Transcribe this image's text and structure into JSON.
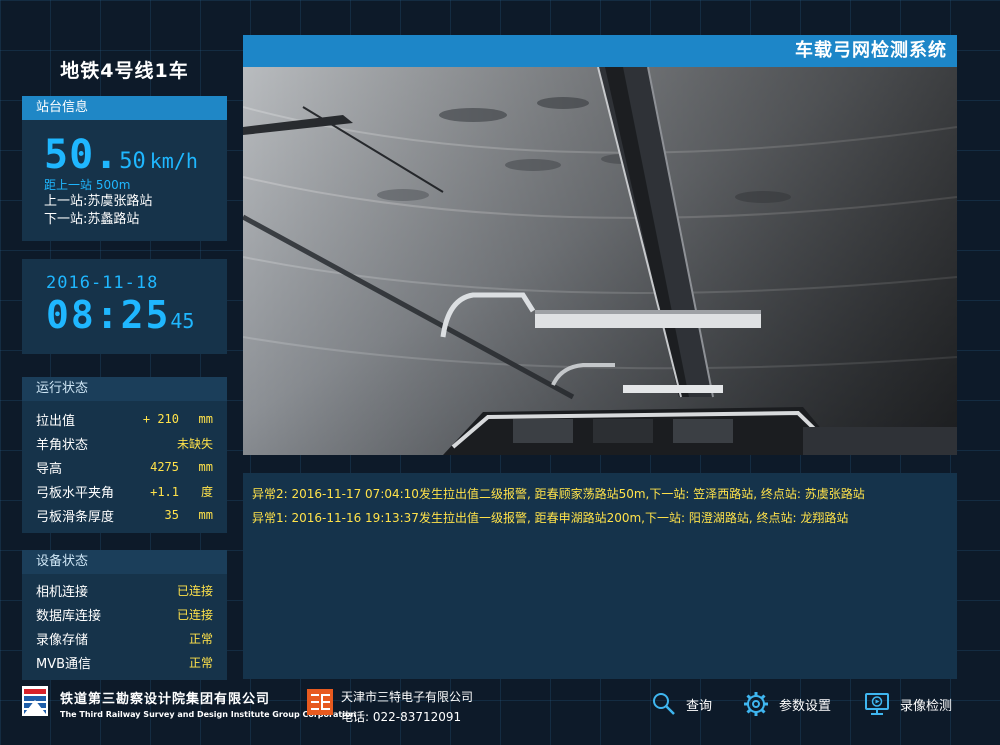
{
  "train_title": "地铁4号线1车",
  "station_info": {
    "header": "站台信息",
    "speed_main": "50.",
    "speed_decimal": "50",
    "speed_unit": "km/h",
    "distance_prev": "距上一站 500m",
    "prev_station": "上一站:苏虞张路站",
    "next_station": "下一站:苏蠡路站"
  },
  "clock": {
    "date": "2016-11-18",
    "time_hm": "08:25",
    "time_sec": "45"
  },
  "run_status": {
    "header": "运行状态",
    "rows": [
      {
        "label": "拉出值",
        "value": "+ 210",
        "unit": "mm"
      },
      {
        "label": "羊角状态",
        "value": "未缺失",
        "unit": ""
      },
      {
        "label": "导高",
        "value": "4275",
        "unit": "mm"
      },
      {
        "label": "弓板水平夹角",
        "value": "+1.1",
        "unit": "度"
      },
      {
        "label": "弓板滑条厚度",
        "value": "35",
        "unit": "mm"
      }
    ]
  },
  "device_status": {
    "header": "设备状态",
    "rows": [
      {
        "label": "相机连接",
        "value": "已连接"
      },
      {
        "label": "数据库连接",
        "value": "已连接"
      },
      {
        "label": "录像存储",
        "value": "正常"
      },
      {
        "label": "MVB通信",
        "value": "正常"
      }
    ]
  },
  "system_title": "车载弓网检测系统",
  "alarms": [
    "异常2: 2016-11-17 07:04:10发生拉出值二级报警, 距春顾家荡路站50m,下一站: 笠泽西路站, 终点站: 苏虞张路站",
    "异常1: 2016-11-16 19:13:37发生拉出值一级报警, 距春申湖路站200m,下一站: 阳澄湖路站, 终点站: 龙翔路站"
  ],
  "footer": {
    "company1_cn": "铁道第三勘察设计院集团有限公司",
    "company1_en": "The Third Railway Survey and Design Institute Group Corporation",
    "company2_cn": "天津市三特电子有限公司",
    "company2_phone": "电话: 022-83712091",
    "buttons": {
      "query": "查询",
      "settings": "参数设置",
      "recording": "录像检测"
    }
  },
  "colors": {
    "accent_blue": "#1fb7ff",
    "header_blue": "#1d86c8",
    "value_yellow": "#ffe24a",
    "background": "#0d1a29"
  }
}
